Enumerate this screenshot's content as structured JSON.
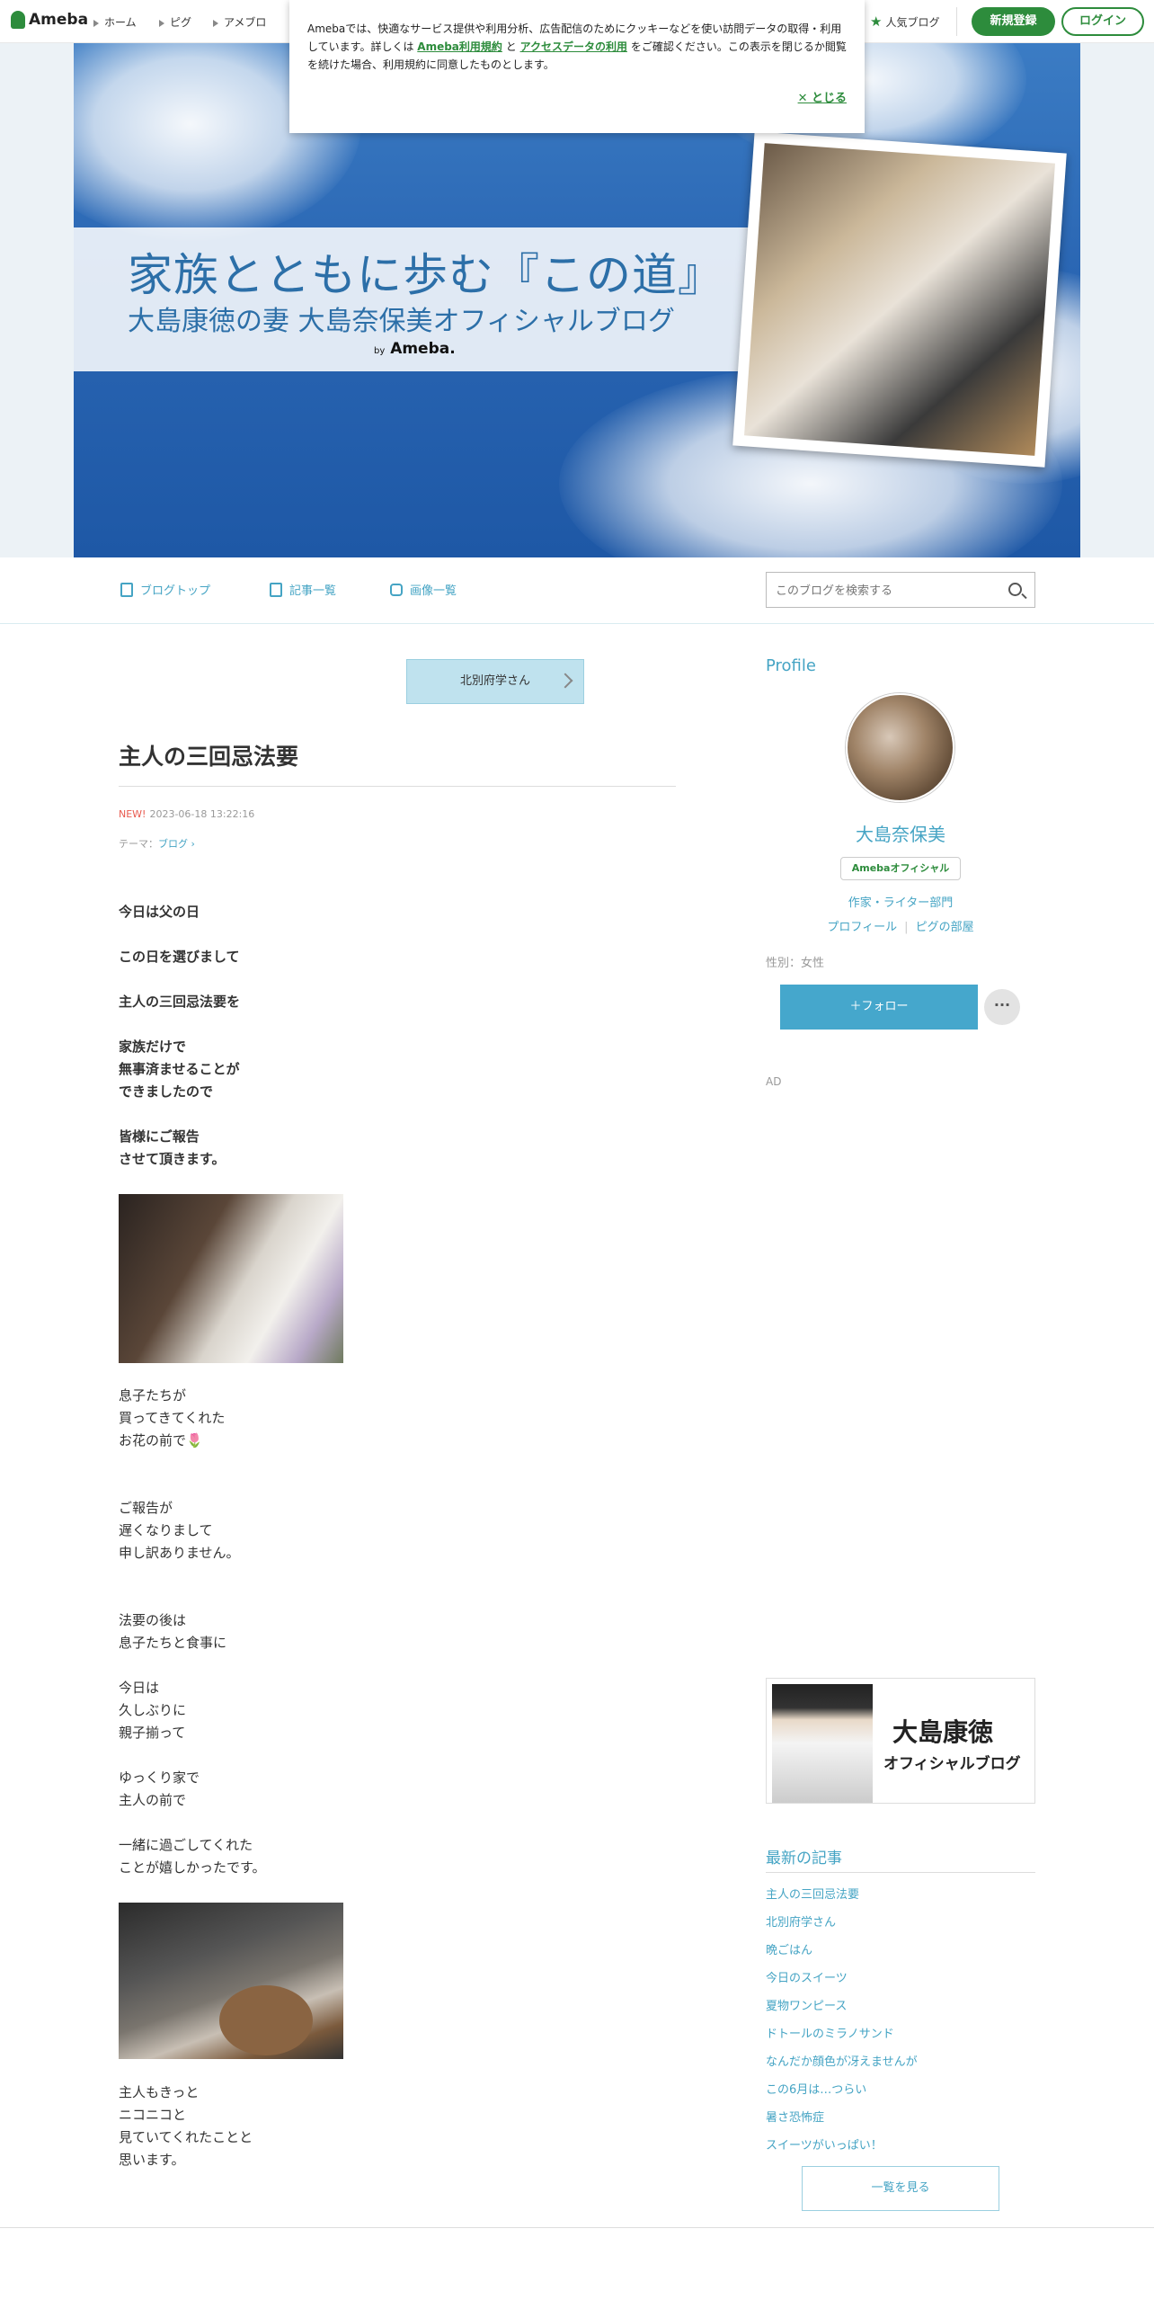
{
  "topbar": {
    "logo": "Ameba",
    "nav": [
      "ホーム",
      "ピグ",
      "アメブロ"
    ],
    "popular": "人気ブログ",
    "register": "新規登録",
    "login": "ログイン"
  },
  "cookie": {
    "text1": "Amebaでは、快適なサービス提供や利用分析、広告配信のためにクッキーなどを使い訪問データの取得・利用しています。詳しくは",
    "link1": "Ameba利用規約",
    "and": "と",
    "link2": "アクセスデータの利用",
    "text2": "をご確認ください。この表示を閉じるか閲覧を続けた場合、利用規約に同意したものとします。",
    "close": "✕ とじる"
  },
  "header": {
    "title": "家族とともに歩む『この道』",
    "subtitle": "大島康徳の妻 大島奈保美オフィシャルブログ",
    "by": "by",
    "by_brand": "Ameba."
  },
  "tabs": {
    "top": "ブログトップ",
    "list": "記事一覧",
    "images": "画像一覧",
    "search_placeholder": "このブログを検索する"
  },
  "article": {
    "prev_nav": "北別府学さん",
    "title": "主人の三回忌法要",
    "new_label": "NEW!",
    "datetime": "2023-06-18 13:22:16",
    "theme_label": "テーマ：",
    "theme": "ブログ",
    "p1": "今日は父の日",
    "p2": "この日を選びまして",
    "p3": "主人の三回忌法要を",
    "p4a": "家族だけで",
    "p4b": "無事済ませることが",
    "p4c": "できましたので",
    "p5a": "皆様にご報告",
    "p5b": "させて頂きます。",
    "p6a": "息子たちが",
    "p6b": "買ってきてくれた",
    "p6c": "お花の前で🌷",
    "p7a": "ご報告が",
    "p7b": "遅くなりまして",
    "p7c": "申し訳ありません。",
    "p8a": "法要の後は",
    "p8b": "息子たちと食事に",
    "p9a": "今日は",
    "p9b": "久しぶりに",
    "p9c": "親子揃って",
    "p10a": "ゆっくり家で",
    "p10b": "主人の前で",
    "p11a": "一緒に過ごしてくれた",
    "p11b": "ことが嬉しかったです。",
    "p12a": "主人もきっと",
    "p12b": "ニコニコと",
    "p12c": "見ていてくれたことと",
    "p12d": "思います。"
  },
  "sidebar": {
    "profile_title": "Profile",
    "author": "大島奈保美",
    "badge": "Amebaオフィシャル",
    "category": "作家・ライター部門",
    "profile_link": "プロフィール",
    "pig_link": "ピグの部屋",
    "gender": "性別：女性",
    "follow": "＋フォロー",
    "more": "···",
    "ad": "AD",
    "husband_name": "大島康徳",
    "husband_sub": "オフィシャルブログ",
    "latest_title": "最新の記事",
    "latest": [
      "主人の三回忌法要",
      "北別府学さん",
      "晩ごはん",
      "今日のスイーツ",
      "夏物ワンピース",
      "ドトールのミラノサンド",
      "なんだか顔色が冴えませんが",
      "この6月は…つらい",
      "暑さ恐怖症",
      "スイーツがいっぱい！"
    ],
    "see_all": "一覧を見る"
  }
}
